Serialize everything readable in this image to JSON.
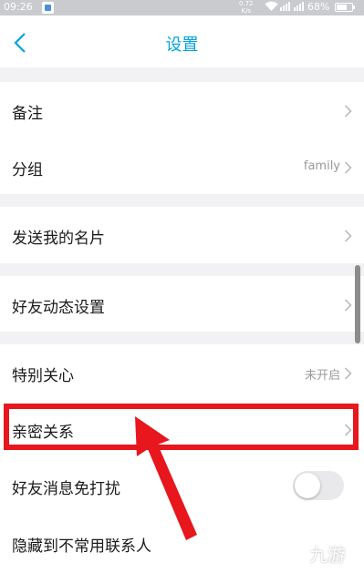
{
  "status_bar": {
    "time": "09:26",
    "speed_value": "0.72",
    "speed_unit": "K/s",
    "battery": "68%",
    "battery_level": 0.68
  },
  "nav": {
    "title": "设置",
    "back_icon": "chevron-left-icon"
  },
  "rows": {
    "remark": {
      "label": "备注"
    },
    "group": {
      "label": "分组",
      "value": "family"
    },
    "send_card": {
      "label": "发送我的名片"
    },
    "moments_settings": {
      "label": "好友动态设置"
    },
    "special_care": {
      "label": "特别关心",
      "value": "未开启"
    },
    "intimate": {
      "label": "亲密关系"
    },
    "dnd": {
      "label": "好友消息免打扰",
      "on": false
    },
    "hide": {
      "label": "隐藏到不常用联系人"
    }
  },
  "watermark": {
    "text": "九游"
  },
  "colors": {
    "accent": "#00a5e0",
    "highlight": "#e8161d",
    "background": "#f2f2f4"
  }
}
